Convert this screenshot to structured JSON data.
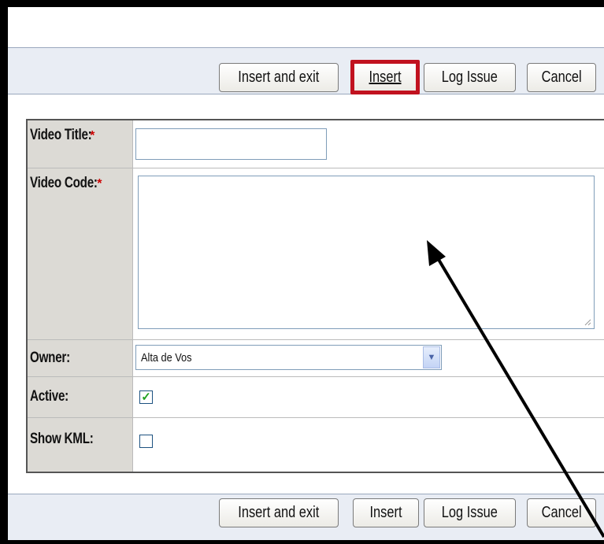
{
  "toolbar_top": {
    "insert_exit": "Insert and exit",
    "insert": "Insert",
    "log_issue": "Log Issue",
    "cancel": "Cancel"
  },
  "toolbar_bottom": {
    "insert_exit": "Insert and exit",
    "insert": "Insert",
    "log_issue": "Log Issue",
    "cancel": "Cancel"
  },
  "form": {
    "video_title_label": "Video Title:",
    "video_title_value": "",
    "video_code_label": "Video Code:",
    "video_code_value": "",
    "required_mark": "*",
    "owner_label": "Owner:",
    "owner_value": "Alta de Vos",
    "active_label": "Active:",
    "active_checked": true,
    "show_kml_label": "Show KML:",
    "show_kml_checked": false
  },
  "colors": {
    "highlight": "#c1121f",
    "required": "#cc0000",
    "label_bg": "#dcdad5",
    "toolbar_bg": "#e9edf4",
    "check": "#21a121"
  },
  "icons": {
    "dropdown": "chevron-down-icon",
    "checkmark": "check-icon",
    "annotation": "arrow-annotation"
  }
}
